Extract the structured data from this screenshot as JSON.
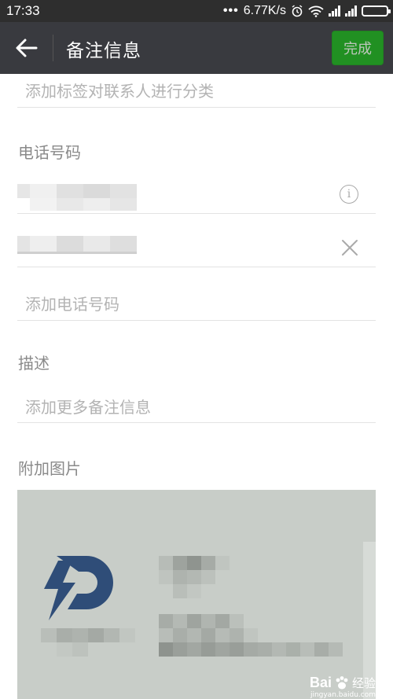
{
  "status_bar": {
    "time": "17:33",
    "network_speed": "6.77K/s",
    "icons": [
      "more-dots-icon",
      "alarm-icon",
      "wifi-icon",
      "signal-icon",
      "signal-icon",
      "battery-icon"
    ]
  },
  "header": {
    "title": "备注信息",
    "done_label": "完成",
    "back_icon": "arrow-left-icon"
  },
  "tags": {
    "placeholder": "添加标签对联系人进行分类"
  },
  "phone": {
    "section_label": "电话号码",
    "numbers": [
      {
        "value": "",
        "icon": "info-icon"
      },
      {
        "value": "",
        "icon": "close-icon"
      }
    ],
    "add_placeholder": "添加电话号码"
  },
  "description": {
    "section_label": "描述",
    "placeholder": "添加更多备注信息"
  },
  "attachment": {
    "section_label": "附加图片"
  },
  "watermark": {
    "brand": "Bai",
    "sub": "经验",
    "url": "jingyan.baidu.com"
  },
  "colors": {
    "status_bar": "#2e2e2e",
    "header": "#393a3f",
    "accent_green": "#1aad19"
  }
}
